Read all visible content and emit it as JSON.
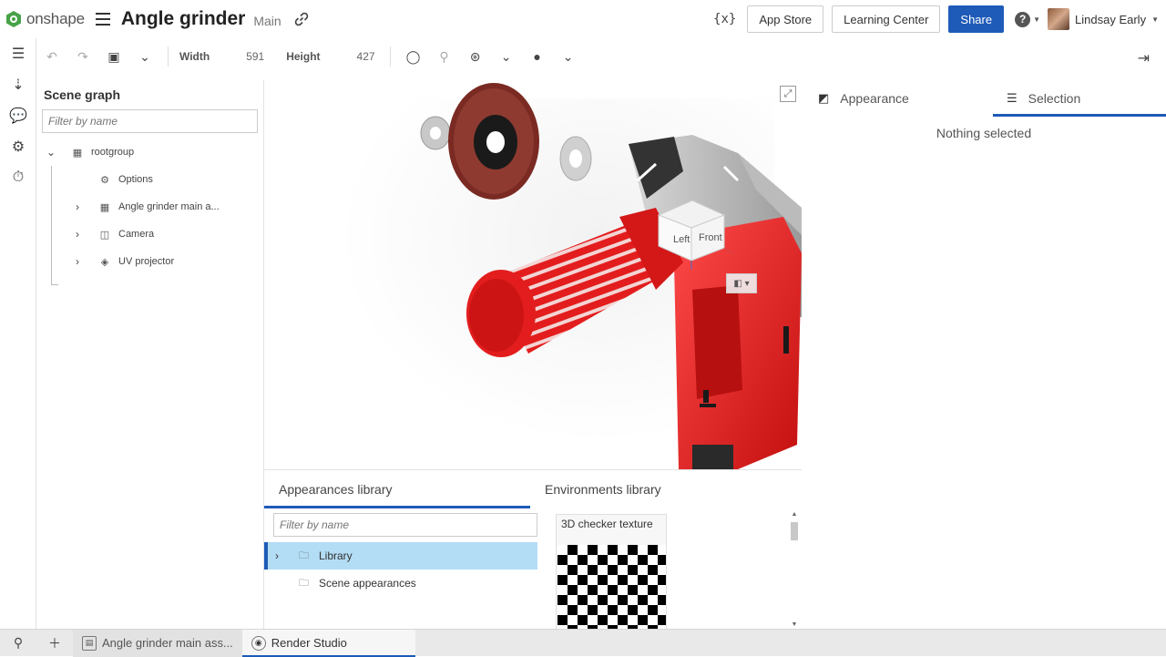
{
  "app": {
    "brand": "onshape",
    "brand_color": "#47a248"
  },
  "document": {
    "title": "Angle grinder",
    "branch": "Main"
  },
  "header": {
    "app_store": "App Store",
    "learning_center": "Learning Center",
    "share": "Share",
    "user_name": "Lindsay Early",
    "accent_color": "#1e5bb8"
  },
  "toolbar": {
    "width_label": "Width",
    "width_value": "591",
    "height_label": "Height",
    "height_value": "427"
  },
  "scene_graph": {
    "title": "Scene graph",
    "filter_placeholder": "Filter by name",
    "items": [
      {
        "label": "rootgroup",
        "icon": "grid-icon",
        "expanded": true
      },
      {
        "label": "Options",
        "icon": "gear-icon"
      },
      {
        "label": "Angle grinder main a...",
        "icon": "grid-icon",
        "expandable": true
      },
      {
        "label": "Camera",
        "icon": "camera-icon",
        "expandable": true
      },
      {
        "label": "UV projector",
        "icon": "cube-icon",
        "expandable": true
      }
    ]
  },
  "viewport": {
    "cube_faces": {
      "left": "Left",
      "front": "Front"
    },
    "theme_color": "#e31d1d"
  },
  "right_panel": {
    "tabs": [
      {
        "label": "Appearance",
        "icon": "appearance-icon"
      },
      {
        "label": "Selection",
        "icon": "list-icon",
        "active": true
      }
    ],
    "empty_message": "Nothing selected"
  },
  "libraries": {
    "tabs": [
      {
        "label": "Appearances library",
        "active": true
      },
      {
        "label": "Environments library"
      }
    ],
    "filter_placeholder": "Filter by name",
    "folders": [
      {
        "label": "Library",
        "selected": true,
        "expandable": true
      },
      {
        "label": "Scene appearances"
      }
    ],
    "environments": [
      {
        "label": "3D checker texture"
      }
    ]
  },
  "bottom_tabs": [
    {
      "label": "Angle grinder main ass...",
      "icon": "assembly-icon"
    },
    {
      "label": "Render Studio",
      "icon": "render-studio-icon",
      "active": true
    }
  ]
}
